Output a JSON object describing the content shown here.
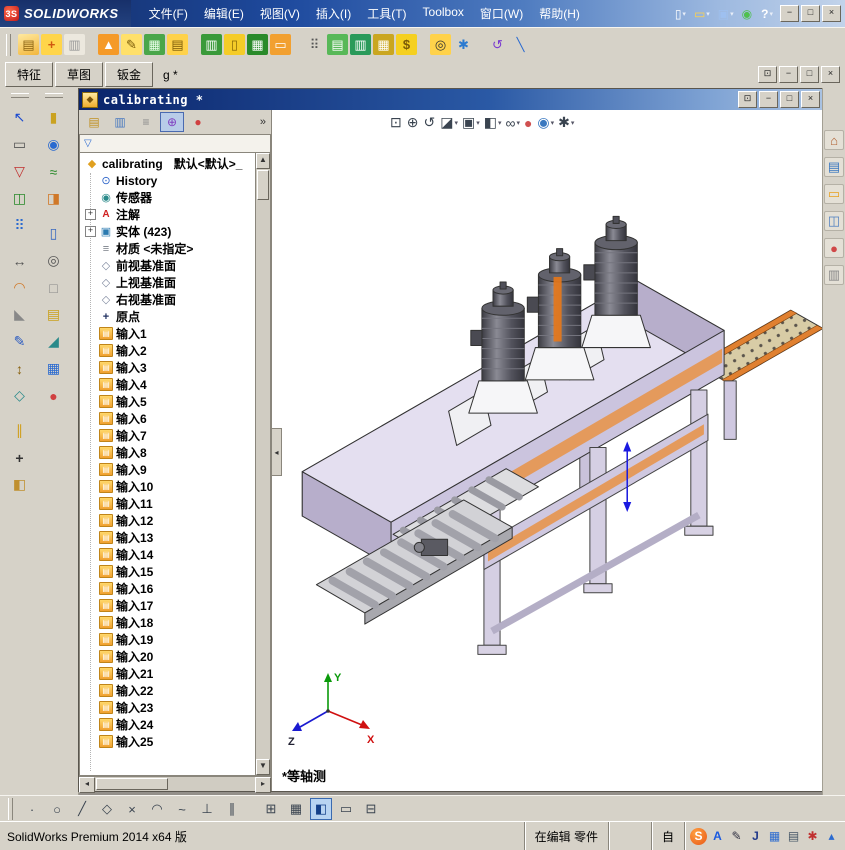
{
  "titlebar": {
    "logo_mark": "3S",
    "logo_text": "SOLIDWORKS",
    "menus": [
      "文件(F)",
      "编辑(E)",
      "视图(V)",
      "插入(I)",
      "工具(T)",
      "Toolbox",
      "窗口(W)",
      "帮助(H)"
    ],
    "icons": [
      {
        "name": "new-document-icon",
        "glyph": "▯",
        "arrow": "▾",
        "style": "color:#ffffff"
      },
      {
        "name": "open-icon",
        "glyph": "▭",
        "arrow": "▾",
        "style": "color:#ffd24a"
      },
      {
        "name": "save-icon",
        "glyph": "▣",
        "arrow": "▾",
        "style": "color:#9ec0f0"
      },
      {
        "name": "rebuild-icon",
        "glyph": "◉",
        "arrow": "",
        "style": "color:#50c050"
      },
      {
        "name": "help-icon",
        "glyph": "?",
        "arrow": "▾",
        "style": "color:#ffffff;font-weight:bold"
      }
    ],
    "window_buttons": [
      {
        "name": "minimize-button",
        "glyph": "−"
      },
      {
        "name": "maximize-button",
        "glyph": "□"
      },
      {
        "name": "close-button",
        "glyph": "×"
      }
    ]
  },
  "toolbar": {
    "icons": [
      {
        "name": "open-part-icon",
        "glyph": "▤",
        "style": "background:linear-gradient(160deg,#ffe9a0,#f2b63c);color:#8a6210"
      },
      {
        "name": "new-window-icon",
        "glyph": "+",
        "style": "background:#ffd54a;color:#d05810;font-weight:bold"
      },
      {
        "name": "print-preview-icon",
        "glyph": "▥",
        "style": "background:#ece8de;color:#999999"
      },
      {
        "name": "alert-icon",
        "glyph": "▲",
        "style": "background:#f59a28;color:#ffffff",
        "gap": "1"
      },
      {
        "name": "note-icon",
        "glyph": "✎",
        "style": "background:#ffe06a;color:#7a5a08"
      },
      {
        "name": "design-binder-icon",
        "glyph": "▦",
        "style": "background:#4aa64a;color:#eaffea"
      },
      {
        "name": "copy-document-icon",
        "glyph": "▤",
        "style": "background:#ffd24a;color:#7a5a08"
      },
      {
        "name": "bom-table-icon",
        "glyph": "▥",
        "style": "background:#3a9a3a;color:#ffffff",
        "gap": "1"
      },
      {
        "name": "column-set-icon",
        "glyph": "▯",
        "style": "background:#f5cc28;color:#8a6a08"
      },
      {
        "name": "table-icon",
        "glyph": "▦",
        "style": "background:#2a8a2a;color:#ffffff"
      },
      {
        "name": "open-folder-icon",
        "glyph": "▭",
        "style": "background:#f2a030;color:#ffffff"
      },
      {
        "name": "view-grid-icon",
        "glyph": "⠿",
        "style": "color:#555555",
        "gap": "1"
      },
      {
        "name": "import-icon",
        "glyph": "▤",
        "style": "background:#58b858;color:#ffffff"
      },
      {
        "name": "export-icon",
        "glyph": "▥",
        "style": "background:#2a9a5a;color:#ffffff"
      },
      {
        "name": "ecalc-icon",
        "glyph": "▦",
        "style": "background:#caa620;color:#ffffff"
      },
      {
        "name": "costing-icon",
        "glyph": "$",
        "style": "background:#f5d020;color:#7a5a08;font-weight:bold"
      },
      {
        "name": "find-reference-icon",
        "glyph": "◎",
        "style": "background:#ffd24a;color:#333333",
        "gap": "1"
      },
      {
        "name": "snap-options-icon",
        "glyph": "✱",
        "style": "color:#2a7ad0"
      },
      {
        "name": "undo-icon",
        "glyph": "↺",
        "style": "color:#7a3ad0",
        "gap": "1"
      },
      {
        "name": "sketch-line-icon",
        "glyph": "╲",
        "style": "color:#2a6ad0"
      }
    ]
  },
  "tabrow": {
    "tabs": [
      "特征",
      "草图",
      "钣金"
    ],
    "fragment": "g *",
    "window_buttons": [
      {
        "name": "doc-fullscreen-button",
        "glyph": "⊡"
      },
      {
        "name": "doc-minimize-button",
        "glyph": "−"
      },
      {
        "name": "doc-restore-button",
        "glyph": "□"
      },
      {
        "name": "doc-close-button",
        "glyph": "×"
      }
    ]
  },
  "left_toolbar": {
    "col1": [
      {
        "name": "select-icon",
        "glyph": "↖",
        "style": "color:#1a4ad0"
      },
      {
        "name": "box-select-icon",
        "glyph": "▭",
        "style": "color:#555555"
      },
      {
        "name": "selection-filter-icon",
        "glyph": "▽",
        "style": "color:#c03030"
      },
      {
        "name": "mirror-entities-icon",
        "glyph": "◫",
        "style": "color:#2a8a2a"
      },
      {
        "name": "linear-pattern-icon",
        "glyph": "⠿",
        "style": "color:#2a6ad0"
      },
      {
        "name": "move-entities-icon",
        "glyph": "↔",
        "style": "color:#555555",
        "gap": "1"
      },
      {
        "name": "fillet-icon",
        "glyph": "◠",
        "style": "color:#d07828"
      },
      {
        "name": "chamfer-icon",
        "glyph": "◣",
        "style": "color:#888888"
      },
      {
        "name": "sketch-icon",
        "glyph": "✎",
        "style": "color:#2a5ac0"
      },
      {
        "name": "smart-dimension-icon",
        "glyph": "↕",
        "style": "color:#8a6210"
      },
      {
        "name": "convert-entities-icon",
        "glyph": "◇",
        "style": "color:#2a8a8a"
      },
      {
        "name": "offset-entities-icon",
        "glyph": "∥",
        "style": "color:#d0a020",
        "gap": "1"
      },
      {
        "name": "measure-icon",
        "glyph": "+",
        "style": "color:#333333;font-weight:bold"
      },
      {
        "name": "section-view-icon",
        "glyph": "◧",
        "style": "color:#c09030"
      }
    ],
    "col2": [
      {
        "name": "extruded-boss-icon",
        "glyph": "▮",
        "style": "color:#caa220"
      },
      {
        "name": "revolved-boss-icon",
        "glyph": "◉",
        "style": "color:#2a6ad0"
      },
      {
        "name": "swept-boss-icon",
        "glyph": "≈",
        "style": "color:#2a8a2a"
      },
      {
        "name": "lofted-boss-icon",
        "glyph": "◨",
        "style": "color:#d07828"
      },
      {
        "name": "extruded-cut-icon",
        "glyph": "▯",
        "style": "color:#3a6ac0",
        "gap": "1"
      },
      {
        "name": "hole-wizard-icon",
        "glyph": "◎",
        "style": "color:#555555"
      },
      {
        "name": "shell-icon",
        "glyph": "□",
        "style": "color:#888888"
      },
      {
        "name": "rib-icon",
        "glyph": "▤",
        "style": "color:#caa220"
      },
      {
        "name": "draft-icon",
        "glyph": "◢",
        "style": "color:#2a8a8a"
      },
      {
        "name": "pattern-feature-icon",
        "glyph": "▦",
        "style": "color:#2a6ad0"
      },
      {
        "name": "appearance-icon",
        "glyph": "●",
        "style": "color:#d04040"
      }
    ]
  },
  "child_window": {
    "title": "calibrating *",
    "window_buttons": [
      {
        "name": "child-fullscreen-button",
        "glyph": "⊡"
      },
      {
        "name": "child-minimize-button",
        "glyph": "−"
      },
      {
        "name": "child-restore-button",
        "glyph": "□"
      },
      {
        "name": "child-close-button",
        "glyph": "×"
      }
    ],
    "tree_tabs": [
      {
        "name": "featuremanager-tab",
        "glyph": "▤",
        "style": "color:#c09020",
        "state": ""
      },
      {
        "name": "propertymanager-tab",
        "glyph": "▥",
        "style": "color:#4a7ac0",
        "state": ""
      },
      {
        "name": "configurationmanager-tab",
        "glyph": "≡",
        "style": "color:#888888",
        "state": ""
      },
      {
        "name": "dimxpertmanager-tab",
        "glyph": "⊕",
        "style": "color:#8040c0",
        "state": "active"
      },
      {
        "name": "displaymanager-tab",
        "glyph": "●",
        "style": "color:#d04040",
        "state": ""
      }
    ],
    "chevron": "»"
  },
  "tree": {
    "root_label": "calibrating",
    "root_config": "默认<默认>_",
    "items": [
      {
        "label": "History",
        "icon": "history"
      },
      {
        "label": "传感器",
        "icon": "sensors"
      },
      {
        "label": "注解",
        "icon": "annotations",
        "expand": "+"
      },
      {
        "label": "实体 (423)",
        "icon": "solids",
        "expand": "+"
      },
      {
        "label": "材质 <未指定>",
        "icon": "material"
      },
      {
        "label": "前视基准面",
        "icon": "plane"
      },
      {
        "label": "上视基准面",
        "icon": "plane"
      },
      {
        "label": "右视基准面",
        "icon": "plane"
      },
      {
        "label": "原点",
        "icon": "origin"
      },
      {
        "label": "输入1",
        "icon": "input"
      },
      {
        "label": "输入2",
        "icon": "input"
      },
      {
        "label": "输入3",
        "icon": "input"
      },
      {
        "label": "输入4",
        "icon": "input"
      },
      {
        "label": "输入5",
        "icon": "input"
      },
      {
        "label": "输入6",
        "icon": "input"
      },
      {
        "label": "输入7",
        "icon": "input"
      },
      {
        "label": "输入8",
        "icon": "input"
      },
      {
        "label": "输入9",
        "icon": "input"
      },
      {
        "label": "输入10",
        "icon": "input"
      },
      {
        "label": "输入11",
        "icon": "input"
      },
      {
        "label": "输入12",
        "icon": "input"
      },
      {
        "label": "输入13",
        "icon": "input"
      },
      {
        "label": "输入14",
        "icon": "input"
      },
      {
        "label": "输入15",
        "icon": "input"
      },
      {
        "label": "输入16",
        "icon": "input"
      },
      {
        "label": "输入17",
        "icon": "input"
      },
      {
        "label": "输入18",
        "icon": "input"
      },
      {
        "label": "输入19",
        "icon": "input"
      },
      {
        "label": "输入20",
        "icon": "input"
      },
      {
        "label": "输入21",
        "icon": "input"
      },
      {
        "label": "输入22",
        "icon": "input"
      },
      {
        "label": "输入23",
        "icon": "input"
      },
      {
        "label": "输入24",
        "icon": "input"
      },
      {
        "label": "输入25",
        "icon": "input"
      }
    ]
  },
  "viewport": {
    "view_label": "*等轴测",
    "axis_labels": {
      "x": "X",
      "y": "Y",
      "z": "Z"
    },
    "headsup": [
      {
        "name": "zoom-fit-icon",
        "glyph": "⊡",
        "arrow": "",
        "style": "color:#3a4450"
      },
      {
        "name": "zoom-area-icon",
        "glyph": "⊕",
        "arrow": "",
        "style": "color:#3a4450"
      },
      {
        "name": "previous-view-icon",
        "glyph": "↺",
        "arrow": "",
        "style": "color:#3a4450"
      },
      {
        "name": "section-view-icon",
        "glyph": "◪",
        "arrow": "▾",
        "style": "color:#3a4450"
      },
      {
        "name": "view-orientation-icon",
        "glyph": "▣",
        "arrow": "▾",
        "style": "color:#3a4450"
      },
      {
        "name": "display-style-icon",
        "glyph": "◧",
        "arrow": "▾",
        "style": "color:#3a4450"
      },
      {
        "name": "hide-show-items-icon",
        "glyph": "∞",
        "arrow": "▾",
        "style": "color:#3a4450"
      },
      {
        "name": "edit-appearance-icon",
        "glyph": "●",
        "arrow": "",
        "style": "color:#d05050"
      },
      {
        "name": "apply-scene-icon",
        "glyph": "◉",
        "arrow": "▾",
        "style": "color:#3a78c0"
      },
      {
        "name": "view-settings-icon",
        "glyph": "✱",
        "arrow": "▾",
        "style": "color:#3a4450"
      }
    ]
  },
  "task_pane": {
    "icons": [
      {
        "name": "home-icon",
        "glyph": "⌂",
        "style": "color:#b06030"
      },
      {
        "name": "design-library-icon",
        "glyph": "▤",
        "style": "color:#3a78c0"
      },
      {
        "name": "file-explorer-icon",
        "glyph": "▭",
        "style": "color:#e8a020"
      },
      {
        "name": "view-palette-icon",
        "glyph": "◫",
        "style": "color:#5080c0"
      },
      {
        "name": "appearances-icon",
        "glyph": "●",
        "style": "color:#d04848"
      },
      {
        "name": "custom-properties-icon",
        "glyph": "▥",
        "style": "color:#888888"
      }
    ]
  },
  "bottom_toolbar": {
    "icons": [
      {
        "name": "sketch-point-icon",
        "glyph": "·",
        "state": ""
      },
      {
        "name": "circle-icon",
        "glyph": "○",
        "state": ""
      },
      {
        "name": "line-icon",
        "glyph": "╱",
        "state": ""
      },
      {
        "name": "polygon-icon",
        "glyph": "◇",
        "state": ""
      },
      {
        "name": "trim-icon",
        "glyph": "×",
        "state": ""
      },
      {
        "name": "arc-icon",
        "glyph": "◠",
        "state": ""
      },
      {
        "name": "spline-icon",
        "glyph": "~",
        "state": ""
      },
      {
        "name": "perpendicular-icon",
        "glyph": "⊥",
        "state": ""
      },
      {
        "name": "parallel-icon",
        "glyph": "∥",
        "state": ""
      },
      {
        "name": "grid-icon",
        "glyph": "⊞",
        "state": "",
        "gap": "1"
      },
      {
        "name": "snap-grid-icon",
        "glyph": "▦",
        "state": ""
      },
      {
        "name": "shaded-with-edges-icon",
        "glyph": "◧",
        "state": "active"
      },
      {
        "name": "wireframe-icon",
        "glyph": "▭",
        "state": ""
      },
      {
        "name": "section-display-icon",
        "glyph": "⊟",
        "state": ""
      }
    ]
  },
  "statusbar": {
    "product": "SolidWorks Premium 2014 x64 版",
    "editing": "在编辑 零件",
    "custom": "自",
    "tray": [
      {
        "name": "sogou-icon",
        "glyph": "S",
        "style": "background:radial-gradient(circle at 35% 30%,#ffa040,#e85818);color:#ffffff;border-radius:50%;font-weight:bold"
      },
      {
        "name": "ime-a-icon",
        "glyph": "A",
        "style": "color:#1a5ae0;font-weight:bold"
      },
      {
        "name": "ime-brush-icon",
        "glyph": "✎",
        "style": "color:#333344"
      },
      {
        "name": "ime-j-icon",
        "glyph": "J",
        "style": "color:#223a8a;font-weight:bold"
      },
      {
        "name": "ime-board-icon",
        "glyph": "▦",
        "style": "color:#2a6ad0"
      },
      {
        "name": "ime-keyboard-icon",
        "glyph": "▤",
        "style": "color:#445566"
      },
      {
        "name": "ime-settings-icon",
        "glyph": "✱",
        "style": "color:#c03030"
      },
      {
        "name": "tray-collapse-icon",
        "glyph": "▴",
        "style": "color:#2a6ad0"
      }
    ]
  }
}
